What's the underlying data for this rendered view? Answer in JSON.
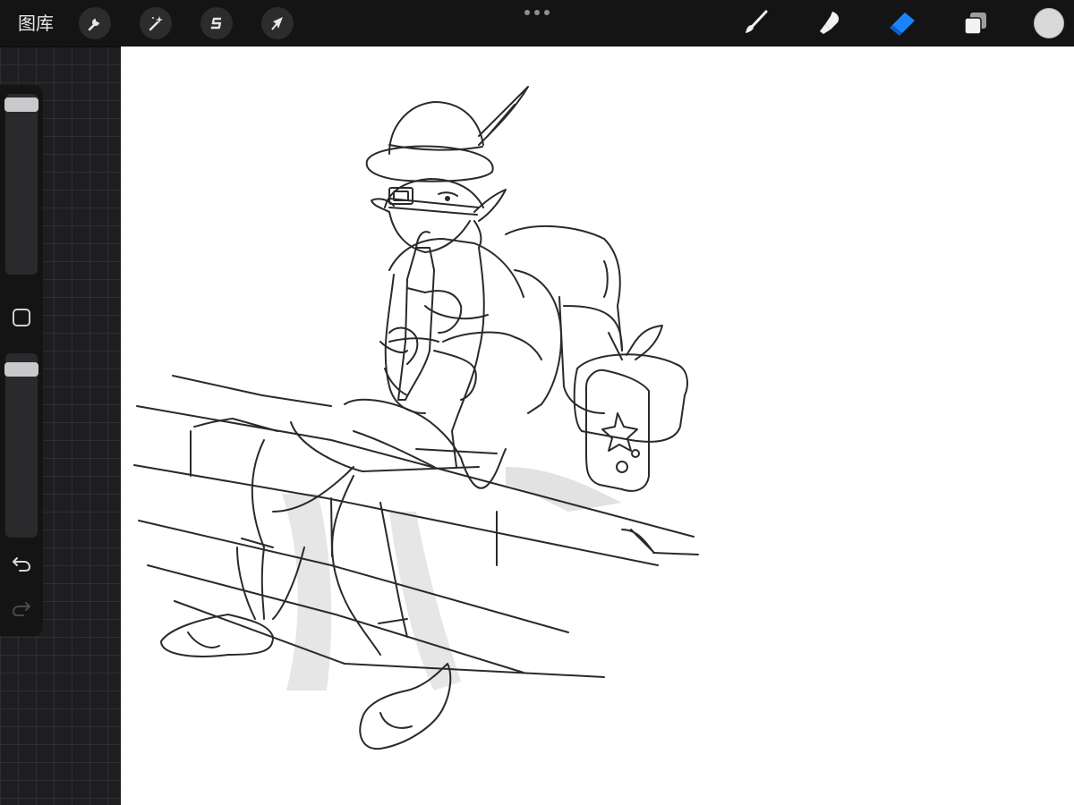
{
  "app": {
    "gallery_label": "图库"
  },
  "toolbar": {
    "left_actions": [
      {
        "name": "actions",
        "icon": "wrench-icon"
      },
      {
        "name": "adjustments",
        "icon": "magic-wand-icon"
      },
      {
        "name": "selection",
        "icon": "selection-s-icon"
      },
      {
        "name": "transform",
        "icon": "arrow-cursor-icon"
      }
    ],
    "more_icon": "more-dots-icon",
    "right_tools": [
      {
        "name": "brush",
        "icon": "brush-icon",
        "active": false
      },
      {
        "name": "smudge",
        "icon": "smudge-icon",
        "active": false
      },
      {
        "name": "eraser",
        "icon": "eraser-icon",
        "active": true
      },
      {
        "name": "layers",
        "icon": "layers-icon",
        "active": false
      }
    ],
    "current_color": "#d9d9d9",
    "accent_color": "#1a84ff"
  },
  "sidebar": {
    "brush_size_level": 0.95,
    "opacity_level": 0.95,
    "modify_icon": "square-modify-icon",
    "undo_icon": "undo-icon",
    "redo_icon": "redo-icon",
    "redo_enabled": false
  },
  "canvas": {
    "background": "#ffffff",
    "artwork": "line-sketch-figure"
  }
}
